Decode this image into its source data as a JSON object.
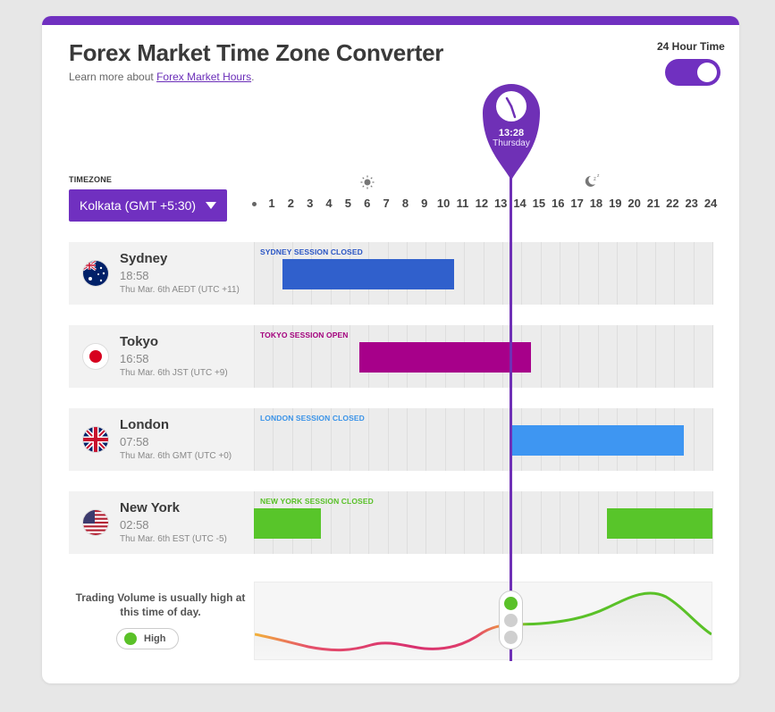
{
  "header": {
    "title": "Forex Market Time Zone Converter",
    "subtitle_prefix": "Learn more about ",
    "subtitle_link": "Forex Market Hours",
    "subtitle_suffix": "."
  },
  "toggle": {
    "label": "24 Hour Time",
    "on": true
  },
  "timezone": {
    "label": "TIMEZONE",
    "selected": "Kolkata (GMT +5:30)"
  },
  "hours": [
    "1",
    "2",
    "3",
    "4",
    "5",
    "6",
    "7",
    "8",
    "9",
    "10",
    "11",
    "12",
    "13",
    "14",
    "15",
    "16",
    "17",
    "18",
    "19",
    "20",
    "21",
    "22",
    "23",
    "24"
  ],
  "day_icons": {
    "day": "sun-icon",
    "night": "moon-icon"
  },
  "current": {
    "time": "13:28",
    "day": "Thursday",
    "icon": "clock-icon"
  },
  "markets": [
    {
      "city": "Sydney",
      "time": "18:58",
      "date": "Thu Mar. 6th AEDT (UTC +11)",
      "session_label": "SYDNEY SESSION CLOSED",
      "label_color": "#2a55c4",
      "bar_color": "#3060cc",
      "flag": "australia-flag-icon",
      "sessions": [
        [
          1.5,
          10.5
        ]
      ]
    },
    {
      "city": "Tokyo",
      "time": "16:58",
      "date": "Thu Mar. 6th JST (UTC +9)",
      "session_label": "TOKYO SESSION OPEN",
      "label_color": "#a3007d",
      "bar_color": "#a7008a",
      "flag": "japan-flag-icon",
      "sessions": [
        [
          5.5,
          14.5
        ]
      ]
    },
    {
      "city": "London",
      "time": "07:58",
      "date": "Thu Mar. 6th GMT (UTC +0)",
      "session_label": "LONDON SESSION CLOSED",
      "label_color": "#3a93e8",
      "bar_color": "#3e96f2",
      "flag": "uk-flag-icon",
      "sessions": [
        [
          13.5,
          22.5
        ]
      ]
    },
    {
      "city": "New York",
      "time": "02:58",
      "date": "Thu Mar. 6th EST (UTC -5)",
      "session_label": "NEW YORK SESSION CLOSED",
      "label_color": "#58c027",
      "bar_color": "#58c52a",
      "flag": "usa-flag-icon",
      "sessions": [
        [
          0,
          3.5
        ],
        [
          18.5,
          24
        ]
      ]
    }
  ],
  "volume": {
    "text": "Trading Volume is usually high at this time of day.",
    "level": "High",
    "level_color": "#5ac128",
    "light": "green"
  }
}
